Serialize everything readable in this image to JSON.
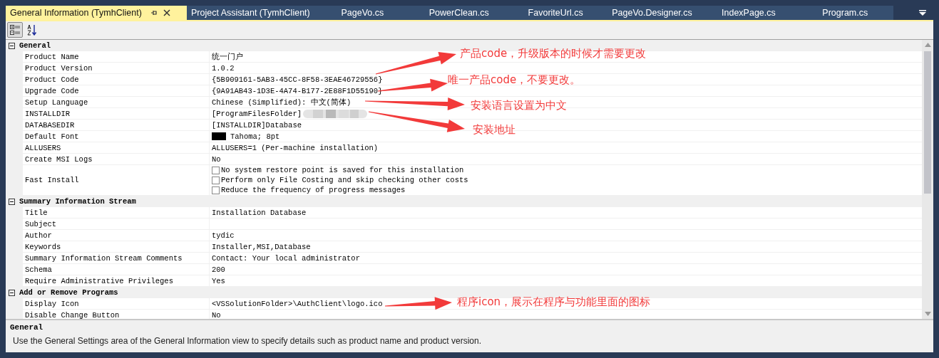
{
  "tabs": [
    {
      "label": "General Information (TymhClient)",
      "selected": true
    },
    {
      "label": "Project Assistant (TymhClient)",
      "selected": false
    },
    {
      "label": "PageVo.cs",
      "selected": false
    },
    {
      "label": "PowerClean.cs",
      "selected": false
    },
    {
      "label": "FavoriteUrl.cs",
      "selected": false
    },
    {
      "label": "PageVo.Designer.cs",
      "selected": false
    },
    {
      "label": "IndexPage.cs",
      "selected": false
    },
    {
      "label": "Program.cs",
      "selected": false
    }
  ],
  "toolbar": [
    {
      "kind": "categorized",
      "selected": true
    },
    {
      "kind": "alphabetical",
      "selected": false
    }
  ],
  "categories": [
    {
      "name": "General",
      "expanded": true,
      "properties": [
        {
          "name": "Product Name",
          "value": "统一门户"
        },
        {
          "name": "Product Version",
          "value": "1.0.2"
        },
        {
          "name": "Product Code",
          "value": "{5B909161-5AB3-45CC-8F58-3EAE46729556}"
        },
        {
          "name": "Upgrade Code",
          "value": "{9A91AB43-1D3E-4A74-B177-2E88F1D55190}"
        },
        {
          "name": "Setup Language",
          "value": "Chinese (Simplified): 中文(简体)"
        },
        {
          "name": "INSTALLDIR",
          "value": "[ProgramFilesFolder]",
          "kind": "redacted"
        },
        {
          "name": "DATABASEDIR",
          "value": "[INSTALLDIR]Database"
        },
        {
          "name": "Default Font",
          "value": "Tahoma; 8pt",
          "kind": "font"
        },
        {
          "name": "ALLUSERS",
          "value": "ALLUSERS=1 (Per-machine installation)"
        },
        {
          "name": "Create MSI Logs",
          "value": "No"
        },
        {
          "name": "Fast Install",
          "kind": "checks",
          "options": [
            {
              "label": "No system restore point is saved for this installation",
              "checked": false
            },
            {
              "label": "Perform only File Costing and skip checking other costs",
              "checked": false
            },
            {
              "label": "Reduce the frequency of progress messages",
              "checked": false
            }
          ]
        }
      ]
    },
    {
      "name": "Summary Information Stream",
      "expanded": true,
      "properties": [
        {
          "name": "Title",
          "value": "Installation Database"
        },
        {
          "name": "Subject"
        },
        {
          "name": "Author",
          "value": "tydic"
        },
        {
          "name": "Keywords",
          "value": "Installer,MSI,Database"
        },
        {
          "name": "Summary Information Stream Comments",
          "value": "Contact:  Your local administrator"
        },
        {
          "name": "Schema",
          "value": "200"
        },
        {
          "name": "Require Administrative Privileges",
          "value": "Yes"
        }
      ]
    },
    {
      "name": "Add or Remove Programs",
      "expanded": true,
      "properties": [
        {
          "name": "Display Icon",
          "value": "<VSSolutionFolder>\\AuthClient\\logo.ico"
        },
        {
          "name": "Disable Change Button",
          "value": "No"
        }
      ]
    }
  ],
  "description": {
    "title": "General",
    "text": "Use the General Settings area of the General Information view to specify details such as product name and product version."
  },
  "annotations": [
    {
      "text": "产品code，升级版本的时候才需要更改"
    },
    {
      "text": "唯一产品code，不要更改。"
    },
    {
      "text": "安装语言设置为中文"
    },
    {
      "text": "安装地址"
    },
    {
      "text": "程序icon，展示在程序与功能里面的图标"
    }
  ]
}
